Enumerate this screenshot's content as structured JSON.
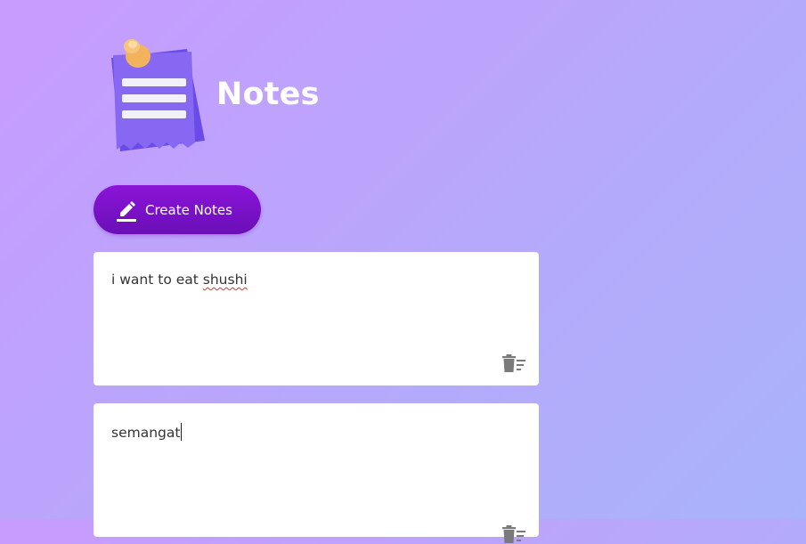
{
  "header": {
    "title": "Notes",
    "logo_icon": "notepad-pushpin-icon"
  },
  "toolbar": {
    "create_label": "Create Notes",
    "create_icon": "pencil-icon"
  },
  "notes": [
    {
      "text_prefix": "i want to eat ",
      "text_misspelled": "shushi",
      "delete_icon": "trash-list-icon"
    },
    {
      "text": "semangat",
      "delete_icon": "trash-list-icon",
      "focused": true
    }
  ],
  "colors": {
    "button": "#7a10c8",
    "note_bg": "#ffffff",
    "text": "#333333",
    "icon_gray": "#7a7a7a",
    "bg_start": "#c89bff",
    "bg_end": "#a9b3fb"
  }
}
